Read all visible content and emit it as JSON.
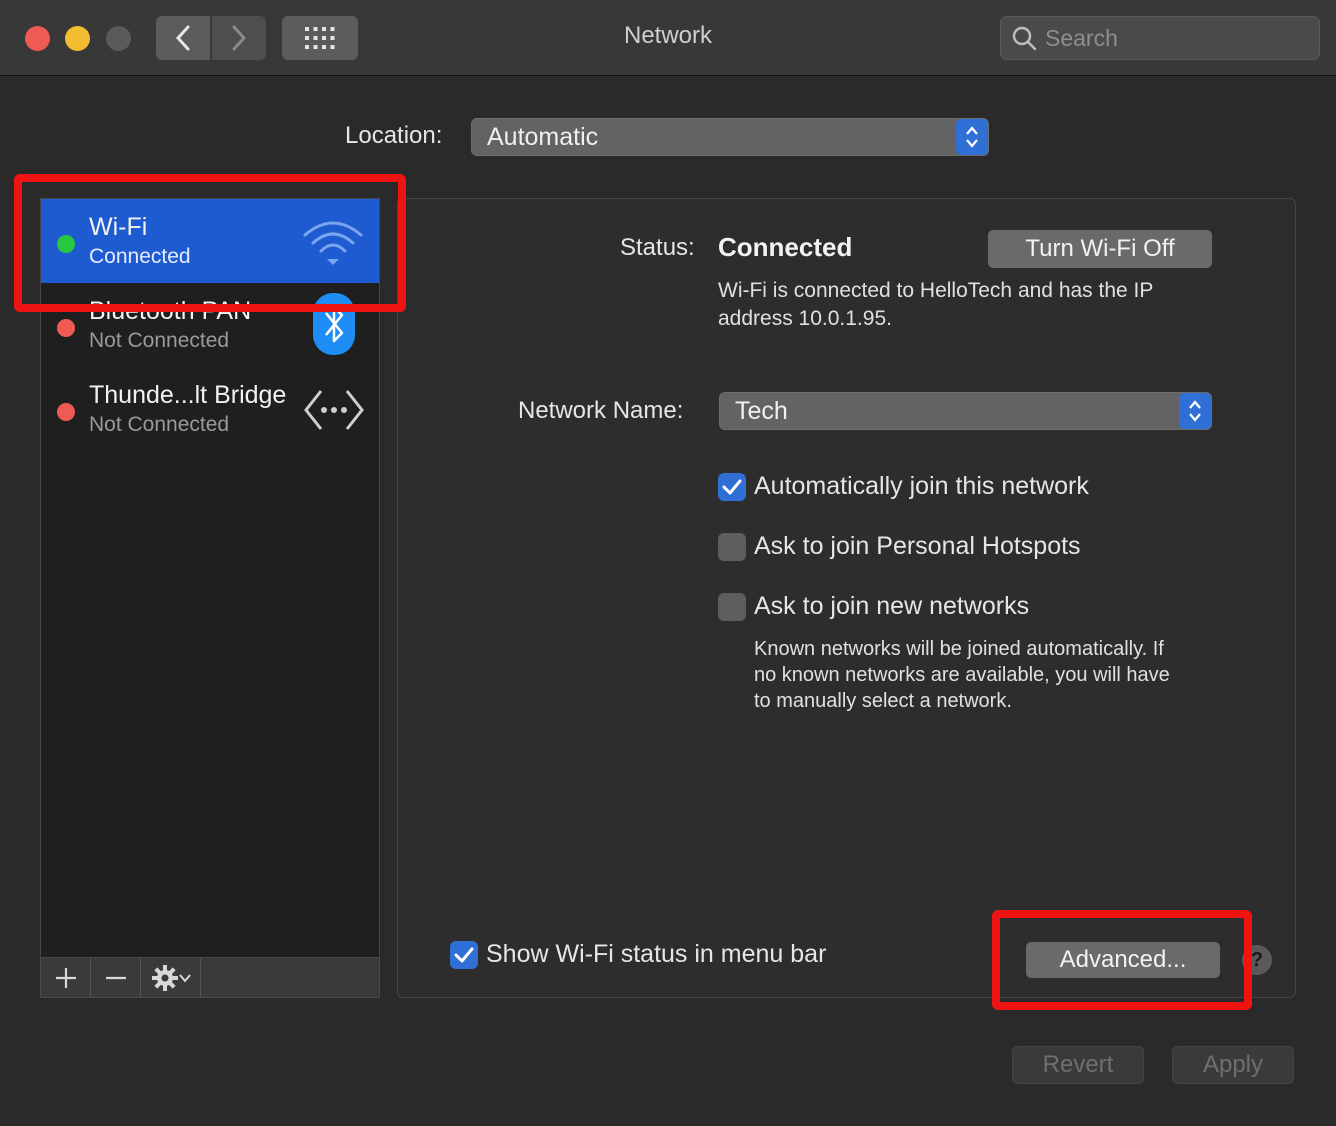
{
  "window": {
    "title": "Network"
  },
  "search": {
    "placeholder": "Search"
  },
  "location": {
    "label": "Location:",
    "value": "Automatic"
  },
  "services": [
    {
      "name": "Wi-Fi",
      "status": "Connected",
      "dot_color": "#28c840",
      "icon": "wifi-icon",
      "selected": true
    },
    {
      "name": "Bluetooth PAN",
      "status": "Not Connected",
      "dot_color": "#ee5b54",
      "icon": "bluetooth-icon",
      "selected": false
    },
    {
      "name": "Thunde...lt Bridge",
      "status": "Not Connected",
      "dot_color": "#ee5b54",
      "icon": "thunderbolt-bridge-icon",
      "selected": false
    }
  ],
  "detail": {
    "status_label": "Status:",
    "status_value": "Connected",
    "turn_off_label": "Turn Wi-Fi Off",
    "status_desc_line1": "Wi-Fi is connected to HelloTech and has the IP",
    "status_desc_line2": "address 10.0.1.95.",
    "network_name_label": "Network Name:",
    "network_name_value": "Tech",
    "options": [
      {
        "label": "Automatically join this network",
        "checked": true
      },
      {
        "label": "Ask to join Personal Hotspots",
        "checked": false
      },
      {
        "label": "Ask to join new networks",
        "checked": false
      }
    ],
    "known_desc_line1": "Known networks will be joined automatically. If",
    "known_desc_line2": "no known networks are available, you will have",
    "known_desc_line3": "to manually select a network.",
    "show_status_label": "Show Wi-Fi status in menu bar",
    "show_status_checked": true,
    "advanced_label": "Advanced...",
    "help_label": "?"
  },
  "footer": {
    "revert_label": "Revert",
    "apply_label": "Apply"
  },
  "colors": {
    "accent": "#2f6fd6",
    "selection": "#1f5bd0",
    "highlight": "#ef1313"
  }
}
